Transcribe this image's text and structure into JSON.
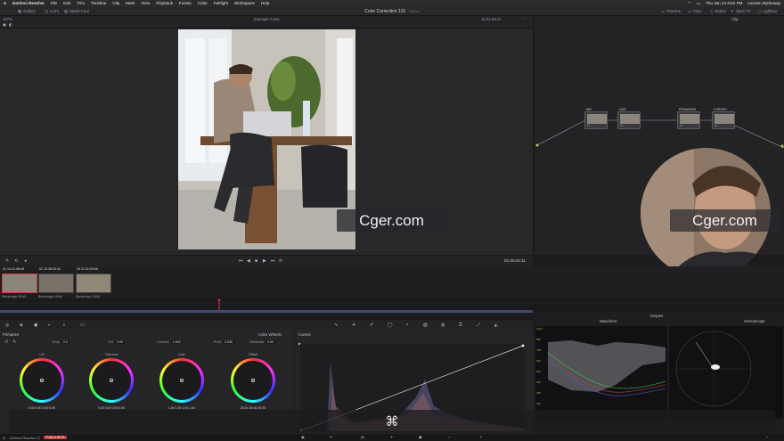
{
  "menubar": {
    "apple": "",
    "app_name": "DaVinci Resolve",
    "menus": [
      "File",
      "Edit",
      "Trim",
      "Timeline",
      "Clip",
      "Mark",
      "View",
      "Playback",
      "Fusion",
      "Color",
      "Fairlight",
      "Workspace",
      "Help"
    ],
    "datetime": "Thu Jan 14  6:52 PM",
    "user": "Landon Bytheway"
  },
  "toolbar": {
    "gallery": "Gallery",
    "luts": "LUTs",
    "media_pool": "Media Pool",
    "project_title": "Color Correction 101",
    "edited": "Edited",
    "timeline": "Timeline",
    "clips": "Clips",
    "nodes": "Nodes",
    "open_fx": "Open FX",
    "lightbox": "Lightbox"
  },
  "viewer": {
    "zoom": "167%",
    "clip_name": "Example Footy",
    "timecode_top": "10:31:08:11",
    "timecode_bottom": "01:00:02:11"
  },
  "node_editor": {
    "mode": "Clip",
    "nodes": [
      {
        "label": "WB",
        "num": "01"
      },
      {
        "label": "HDR",
        "num": "02"
      },
      {
        "label": "PRIMARIES",
        "num": "03"
      },
      {
        "label": "CURVES",
        "num": "04"
      }
    ]
  },
  "clips": {
    "items": [
      {
        "tc": "10:31:08:48",
        "idx": "01",
        "name": "Blackmagic RAW"
      },
      {
        "tc": "10:36:53:44",
        "idx": "02",
        "name": "Blackmagic RAW"
      },
      {
        "tc": "11:32:20:08",
        "idx": "03",
        "name": "Blackmagic RAW"
      }
    ]
  },
  "primaries": {
    "title": "Primaries",
    "mode": "Color Wheels",
    "temp_label": "Temp",
    "temp": "0.0",
    "tint_label": "Tint",
    "tint": "0.00",
    "contrast_label": "Contrast",
    "contrast": "1.000",
    "pivot_label": "Pivot",
    "pivot": "0.435",
    "middetail_label": "Mid/Detail",
    "middetail": "0.00",
    "wheels": [
      {
        "name": "Lift",
        "values": "0.00  0.00  0.00  0.00"
      },
      {
        "name": "Gamma",
        "values": "0.00  0.00  0.00  0.00"
      },
      {
        "name": "Gain",
        "values": "1.00  1.00  1.00  1.00"
      },
      {
        "name": "Offset",
        "values": "25.00  25.00  25.00"
      }
    ]
  },
  "curves": {
    "title": "Curves"
  },
  "scopes": {
    "title": "Scopes",
    "left_scope": "Waveform",
    "right_scope": "Vectorscope",
    "scale": [
      "1023",
      "896",
      "768",
      "640",
      "512",
      "384",
      "256",
      "128",
      "0"
    ]
  },
  "watermark": "Cger.com",
  "status": {
    "app": "DaVinci Resolve 17",
    "badge": "PUBLIC BETA"
  },
  "overlay": {
    "icon": "command-icon"
  }
}
